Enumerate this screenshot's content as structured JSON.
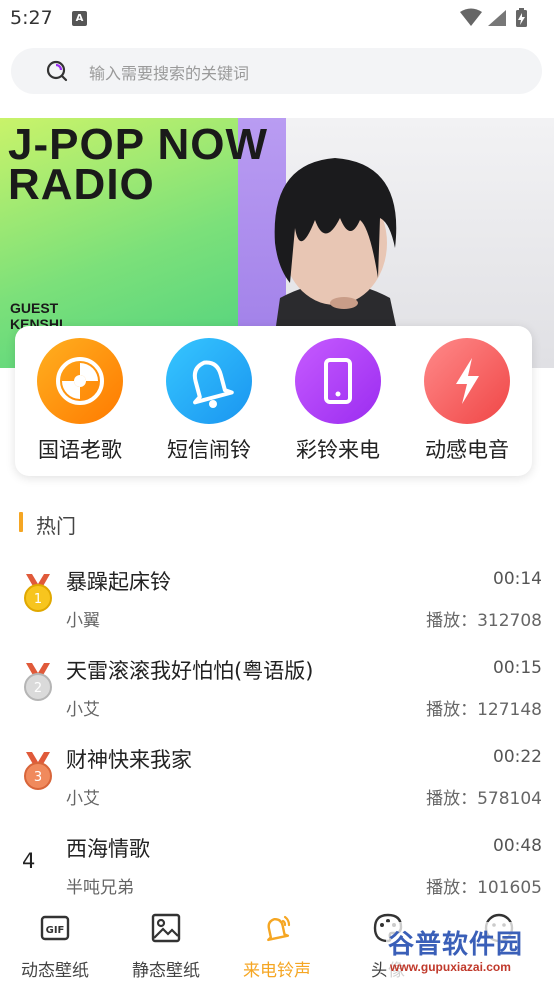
{
  "status": {
    "time": "5:27",
    "notification_letter": "A"
  },
  "search": {
    "placeholder": "输入需要搜索的关键词"
  },
  "banner": {
    "title_line1": "J-POP NOW",
    "title_line2": "RADIO",
    "guest": "GUEST",
    "guest_name": "KENSHI"
  },
  "categories": [
    {
      "label": "国语老歌",
      "icon": "cd-icon",
      "color_from": "#ffb020",
      "color_to": "#ff7a00"
    },
    {
      "label": "短信闹铃",
      "icon": "bell-icon",
      "color_from": "#36c6ff",
      "color_to": "#1a95f0"
    },
    {
      "label": "彩铃来电",
      "icon": "phone-icon",
      "color_from": "#c65bff",
      "color_to": "#9b2cf0"
    },
    {
      "label": "动感电音",
      "icon": "lightning-icon",
      "color_from": "#ff7a7a",
      "color_to": "#f04646"
    }
  ],
  "hot": {
    "title": "热门",
    "accent": "#f5a623",
    "songs": [
      {
        "rank": "1",
        "medal": "gold-medal-icon",
        "title": "暴躁起床铃",
        "artist": "小翼",
        "duration": "00:14",
        "plays": "播放：312708"
      },
      {
        "rank": "2",
        "medal": "silver-medal-icon",
        "title": "天雷滚滚我好怕怕(粤语版)",
        "artist": "小艾",
        "duration": "00:15",
        "plays": "播放：127148"
      },
      {
        "rank": "3",
        "medal": "bronze-medal-icon",
        "title": "财神快来我家",
        "artist": "小艾",
        "duration": "00:22",
        "plays": "播放：578104"
      },
      {
        "rank": "4",
        "medal": "",
        "title": "西海情歌",
        "artist": "半吨兄弟",
        "duration": "00:48",
        "plays": "播放：101605"
      }
    ]
  },
  "bottom_nav": [
    {
      "label": "动态壁纸",
      "icon": "gif-icon",
      "active": false
    },
    {
      "label": "静态壁纸",
      "icon": "image-icon",
      "active": false
    },
    {
      "label": "来电铃声",
      "icon": "ringing-bell-icon",
      "active": true
    },
    {
      "label": "头像",
      "icon": "palette-icon",
      "active": false
    },
    {
      "label": "",
      "icon": "face-icon",
      "active": false
    }
  ],
  "watermark": {
    "main": "谷普软件园",
    "url": "www.gupuxiazai.com"
  }
}
